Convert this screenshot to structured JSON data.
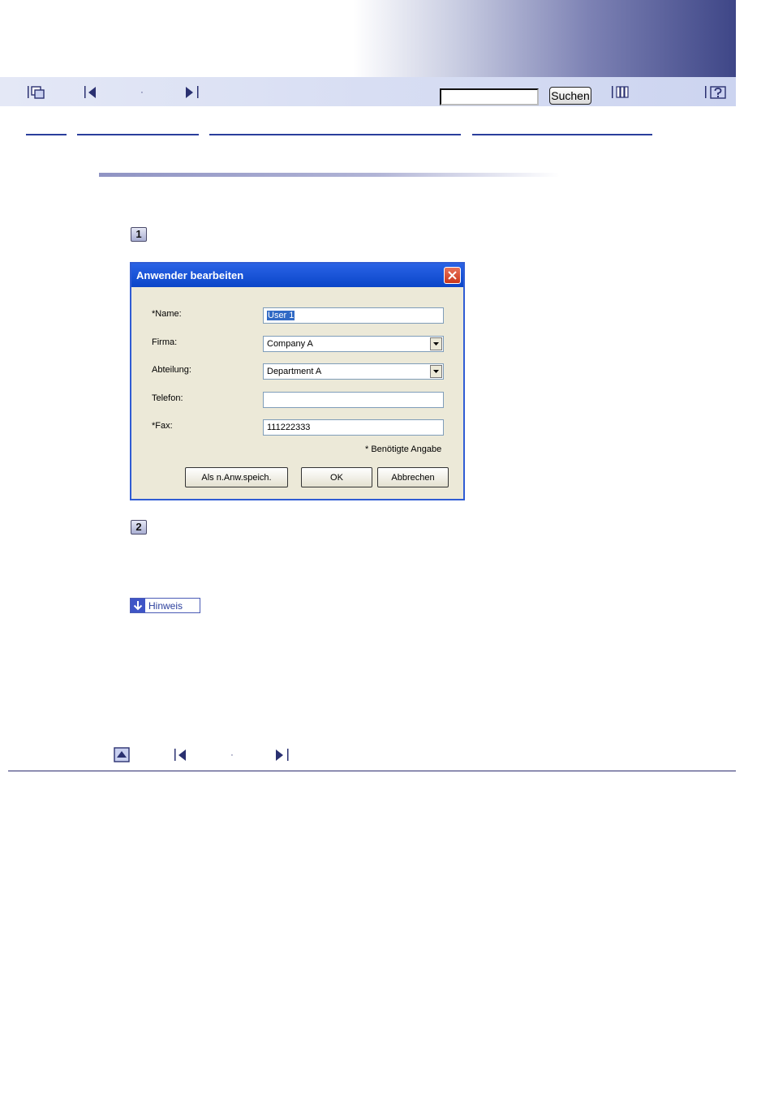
{
  "toolbar": {
    "search": {
      "value": "",
      "button_label": "Suchen"
    },
    "icons": [
      "top-page-icon",
      "previous-page-icon",
      "next-page-icon",
      "index-icon",
      "help-icon"
    ],
    "separator_dot": "·"
  },
  "dialog": {
    "title": "Anwender bearbeiten",
    "fields": [
      {
        "label": "*Name:",
        "value": "User 1",
        "type": "text"
      },
      {
        "label": "Firma:",
        "value": "Company A",
        "type": "select"
      },
      {
        "label": "Abteilung:",
        "value": "Department A",
        "type": "select"
      },
      {
        "label": "Telefon:",
        "value": "",
        "type": "text"
      },
      {
        "label": "*Fax:",
        "value": "111222333",
        "type": "text"
      }
    ],
    "required_note": "* Benötigte Angabe",
    "buttons": {
      "save_as_new": "Als n.Anw.speich.",
      "ok": "OK",
      "cancel": "Abbrechen"
    }
  },
  "steps": [
    "1",
    "2"
  ],
  "note_button": {
    "label": "Hinweis"
  },
  "footer": {
    "separator_dot": "·"
  },
  "colors": {
    "link": "#2a3e9c",
    "toolbar": "#ccd4f0",
    "dialog_title": "#0a45c8"
  }
}
